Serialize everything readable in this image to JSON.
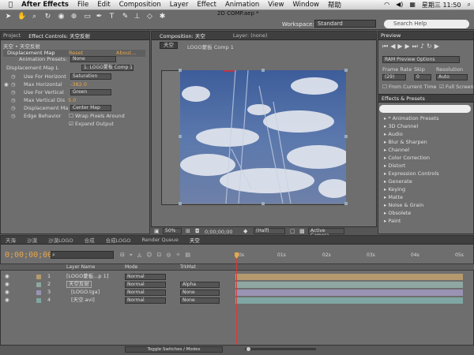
{
  "menubar": {
    "app": "After Effects",
    "items": [
      "File",
      "Edit",
      "Composition",
      "Layer",
      "Effect",
      "Animation",
      "View",
      "Window",
      "帮助"
    ],
    "clock": "星期三 11:50"
  },
  "toolbar": {
    "doc_title": "2D COMP.aep *",
    "workspace_label": "Workspace:",
    "workspace_value": "Standard",
    "search_placeholder": "Search Help"
  },
  "left_panel": {
    "tabs": [
      "Project",
      "Effect Controls: 天空反射"
    ],
    "breadcrumb": "天空 • 天空反射",
    "effect_name": "Displacement Map",
    "reset": "Reset",
    "about": "About...",
    "rows": [
      {
        "label": "Animation Presets:",
        "value": "None"
      },
      {
        "label": "Displacement Map L",
        "value": "1. LOGO蒙板 Comp 1"
      },
      {
        "label": "Use For Horizont",
        "value": "Saturation"
      },
      {
        "label": "Max Horizontal",
        "value": "-382.0"
      },
      {
        "label": "Use For Vertical",
        "value": "Green"
      },
      {
        "label": "Max Vertical Dis",
        "value": "5.0"
      },
      {
        "label": "Displacement Ma",
        "value": "Center Map"
      },
      {
        "label": "Edge Behavior",
        "value": "Wrap Pixels Around"
      },
      {
        "label": "",
        "value": "Expand Output"
      }
    ]
  },
  "comp_panel": {
    "tabs": [
      "Composition: 天空",
      "Layer: (none)"
    ],
    "crumbs": [
      "天空",
      "LOGO蒙板 Comp 1"
    ],
    "zoom": "50%",
    "timecode": "0;00;00;00",
    "resolution": "(Half)",
    "camera": "Active Camera"
  },
  "right_panel": {
    "preview_title": "Preview",
    "ram_preview": "RAM Preview Options",
    "frame_rate_label": "Frame Rate",
    "skip_label": "Skip",
    "resolution_label": "Resolution",
    "frame_rate": "(29)",
    "skip": "0",
    "resolution": "Auto",
    "from_current": "From Current Time",
    "full_screen": "Full Screen",
    "effects_title": "Effects & Presets",
    "effects": [
      "* Animation Presets",
      "3D Channel",
      "Audio",
      "Blur & Sharpen",
      "Channel",
      "Color Correction",
      "Distort",
      "Expression Controls",
      "Generate",
      "Keying",
      "Matte",
      "Noise & Grain",
      "Obsolete",
      "Paint"
    ]
  },
  "timeline": {
    "tabs": [
      "天海",
      "沙漠",
      "沙漠LOGO",
      "合成",
      "合成LOGO",
      "Render Queue",
      "天空"
    ],
    "timecode": "0;00;00;00",
    "headers": {
      "layer_name": "Layer Name",
      "mode": "Mode",
      "trkmat": "TrkMat"
    },
    "ruler": [
      "0s",
      "01s",
      "02s",
      "03s",
      "04s",
      "05s"
    ],
    "layers": [
      {
        "num": "1",
        "name": "[LOGO蒙板...p 1]",
        "mode": "Normal",
        "trkmat": "",
        "color": "#b49a6e"
      },
      {
        "num": "2",
        "name": "天空反射",
        "mode": "Normal",
        "trkmat": "Alpha",
        "color": "#8fa7a0"
      },
      {
        "num": "3",
        "name": "[LOGO.tga]",
        "mode": "Normal",
        "trkmat": "None",
        "color": "#9a93b3"
      },
      {
        "num": "4",
        "name": "[天空.avi]",
        "mode": "Normal",
        "trkmat": "None",
        "color": "#7fa6a2"
      }
    ],
    "toggle_label": "Toggle Switches / Modes"
  }
}
